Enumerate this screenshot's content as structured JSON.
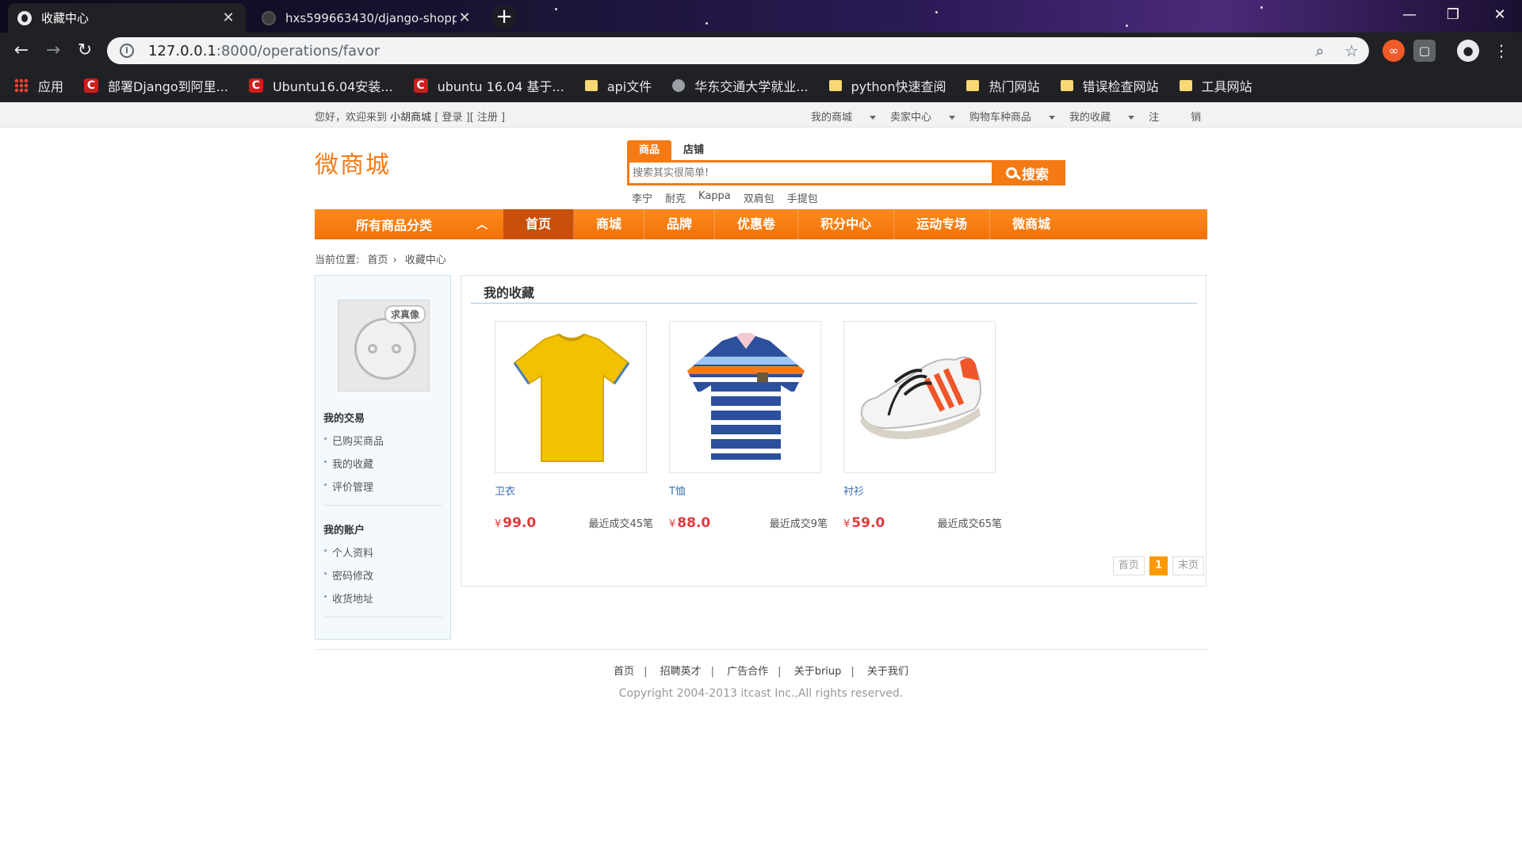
{
  "browser": {
    "tabs": [
      {
        "title": "收藏中心",
        "active": true
      },
      {
        "title": "hxs599663430/django-shoppi",
        "active": false
      }
    ],
    "address": {
      "host": "127.0.0.1",
      "path": ":8000/operations/favor"
    },
    "bookmarks": [
      {
        "label": "应用",
        "icon": "apps-icon"
      },
      {
        "label": "部署Django到阿里...",
        "icon": "csdn-icon"
      },
      {
        "label": "Ubuntu16.04安装...",
        "icon": "csdn-icon"
      },
      {
        "label": "ubuntu 16.04 基于...",
        "icon": "csdn-icon"
      },
      {
        "label": "api文件",
        "icon": "folder-icon"
      },
      {
        "label": "华东交通大学就业...",
        "icon": "globe-icon"
      },
      {
        "label": "python快速查阅",
        "icon": "folder-icon"
      },
      {
        "label": "热门网站",
        "icon": "folder-icon"
      },
      {
        "label": "错误检查网站",
        "icon": "folder-icon"
      },
      {
        "label": "工具网站",
        "icon": "folder-icon"
      }
    ]
  },
  "topbar": {
    "welcome": "您好，欢迎来到",
    "shop_name": "小胡商城",
    "login": "[ 登录 ][ 注册 ]",
    "links": [
      "我的商城",
      "卖家中心",
      "购物车种商品",
      "我的收藏"
    ],
    "logout_a": "注",
    "logout_b": "销"
  },
  "header": {
    "logo": "微商城",
    "search_tabs": [
      "商品",
      "店铺"
    ],
    "search_placeholder": "搜索其实很简单!",
    "search_button": "搜索",
    "hot_words": [
      "李宁",
      "耐克",
      "Kappa",
      "双肩包",
      "手提包"
    ]
  },
  "nav": {
    "all_categories": "所有商品分类",
    "items": [
      "首页",
      "商城",
      "品牌",
      "优惠卷",
      "积分中心",
      "运动专场",
      "微商城"
    ],
    "active": "首页"
  },
  "breadcrumb": {
    "label": "当前位置:",
    "home": "首页",
    "sep": "›",
    "current": "收藏中心"
  },
  "sidebar": {
    "avatar_tag": "求真像",
    "groups": [
      {
        "title": "我的交易",
        "items": [
          "已购买商品",
          "我的收藏",
          "评价管理"
        ]
      },
      {
        "title": "我的账户",
        "items": [
          "个人资料",
          "密码修改",
          "收货地址"
        ]
      }
    ]
  },
  "main": {
    "title": "我的收藏",
    "products": [
      {
        "name": "卫衣",
        "currency": "¥",
        "price": "99.0",
        "deal": "最近成交45笔"
      },
      {
        "name": "T恤",
        "currency": "¥",
        "price": "88.0",
        "deal": "最近成交9笔"
      },
      {
        "name": "衬衫",
        "currency": "¥",
        "price": "59.0",
        "deal": "最近成交65笔"
      }
    ],
    "pager": {
      "first": "首页",
      "current": "1",
      "last": "末页"
    }
  },
  "footer": {
    "links": [
      "首页",
      "招聘英才",
      "广告合作",
      "关于briup",
      "关于我们"
    ],
    "separator": "|",
    "copyright": "Copyright 2004-2013 itcast Inc.,All rights reserved."
  },
  "colors": {
    "brand": "#f57a14",
    "price": "#e4393c",
    "link": "#3b6fb0"
  }
}
